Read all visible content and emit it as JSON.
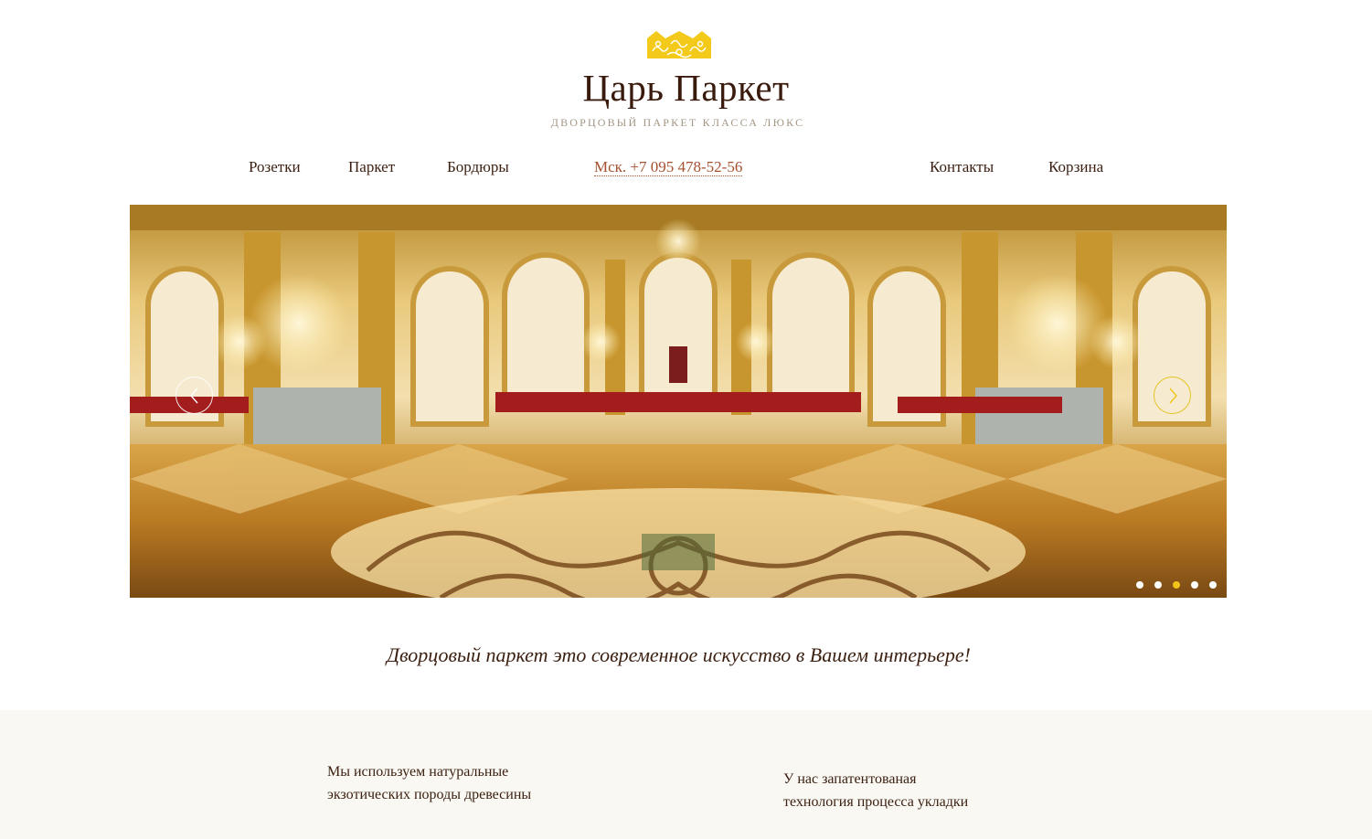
{
  "header": {
    "logo_icon": "crown-icon",
    "title": "Царь Паркет",
    "subtitle": "ДВОРЦОВЫЙ ПАРКЕТ КЛАССА ЛЮКС"
  },
  "nav": {
    "rosettes": "Розетки",
    "parquet": "Паркет",
    "borders": "Бордюры",
    "phone": "Мск. +7 095 478-52-56",
    "contacts": "Контакты",
    "cart": "Корзина"
  },
  "slider": {
    "image": "palace-hall-parquet-photo",
    "prev_icon": "chevron-left-icon",
    "next_icon": "chevron-right-icon",
    "slide_count": 5,
    "active_slide": 3
  },
  "tagline": "Дворцовый паркет это современное искусство в Вашем интерьере!",
  "features": {
    "wood": [
      "Мы используем натуральные",
      "экзотических породы древесины"
    ],
    "technology": [
      "У нас запатентованая",
      "технология процесса укладки"
    ]
  },
  "colors": {
    "brown_text": "#3b1f10",
    "accent_link": "#a5502f",
    "gold": "#f0c419",
    "features_bg": "#f9f8f3"
  }
}
